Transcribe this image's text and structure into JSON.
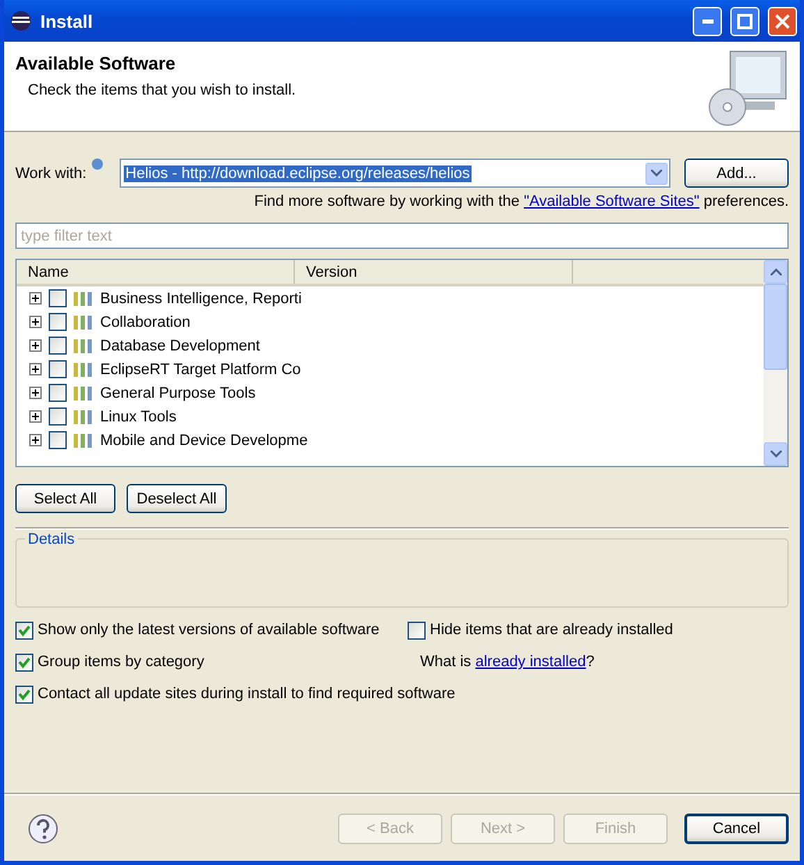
{
  "window": {
    "title": "Install"
  },
  "header": {
    "title": "Available Software",
    "subtitle": "Check the items that you wish to install."
  },
  "work_with": {
    "label": "Work with:",
    "value": "Helios - http://download.eclipse.org/releases/helios",
    "button": "Add..."
  },
  "more_sites": {
    "before": "Find more software by working with the ",
    "link": "\"Available Software Sites\"",
    "after": " preferences."
  },
  "filter": {
    "placeholder": "type filter text"
  },
  "table": {
    "columns": [
      "Name",
      "Version"
    ],
    "rows": [
      {
        "name": "Business Intelligence, Reporti",
        "checked": false,
        "expanded": false
      },
      {
        "name": "Collaboration",
        "checked": false,
        "expanded": false
      },
      {
        "name": "Database Development",
        "checked": false,
        "expanded": false
      },
      {
        "name": "EclipseRT Target Platform Co",
        "checked": false,
        "expanded": false
      },
      {
        "name": "General Purpose Tools",
        "checked": false,
        "expanded": false
      },
      {
        "name": "Linux Tools",
        "checked": false,
        "expanded": false
      },
      {
        "name": "Mobile and Device Developme",
        "checked": false,
        "expanded": false
      }
    ]
  },
  "selection_buttons": [
    "Select All",
    "Deselect All"
  ],
  "details": {
    "title": "Details"
  },
  "options": [
    {
      "kind": "checkbox",
      "label": "Show only the latest versions of available software",
      "checked": true
    },
    {
      "kind": "checkbox",
      "label": "Hide items that are already installed",
      "checked": false
    },
    {
      "kind": "checkbox",
      "label": "Group items by category",
      "checked": true
    },
    {
      "kind": "link",
      "before": "What is ",
      "link": "already installed",
      "after": "?"
    },
    {
      "kind": "checkbox",
      "label": "Contact all update sites during install to find required software",
      "checked": true
    }
  ],
  "footer_buttons": [
    {
      "label": "< Back",
      "disabled": true
    },
    {
      "label": "Next >",
      "disabled": true
    },
    {
      "label": "Finish",
      "disabled": true
    },
    {
      "label": "Cancel",
      "disabled": false
    }
  ]
}
